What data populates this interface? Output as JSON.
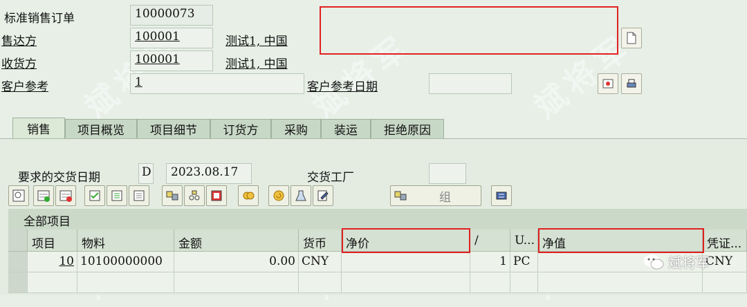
{
  "header": {
    "order_label": "标准销售订单",
    "order_number": "10000073",
    "soldto_label": "售达方",
    "soldto_value": "100001",
    "soldto_desc": "测试1, 中国",
    "shipto_label": "收货方",
    "shipto_value": "100001",
    "shipto_desc": "测试1, 中国",
    "custref_label": "客户参考",
    "custref_value": "1",
    "custref_date_label": "客户参考日期",
    "custref_date_value": ""
  },
  "tabs": [
    {
      "label": "销售",
      "active": true
    },
    {
      "label": "项目概览"
    },
    {
      "label": "项目细节"
    },
    {
      "label": "订货方"
    },
    {
      "label": "采购"
    },
    {
      "label": "装运"
    },
    {
      "label": "拒绝原因"
    }
  ],
  "sales_tab": {
    "req_delivery_label": "要求的交货日期",
    "req_delivery_type": "D",
    "req_delivery_date": "2023.08.17",
    "plant_label": "交货工厂",
    "plant_value": "",
    "group_label": "组"
  },
  "items": {
    "section_title": "全部项目",
    "columns": [
      "项目",
      "物料",
      "金额",
      "货币",
      "净价",
      "/",
      "U...",
      "净值",
      "凭证..."
    ],
    "rows": [
      {
        "item": "10",
        "material": "10100000000",
        "amount": "0.00",
        "currency": "CNY",
        "net_price": "",
        "per": "1",
        "unit": "PC",
        "net_value": "",
        "doc_currency": "CNY"
      }
    ]
  },
  "watermark": {
    "text_brand": "斌将军",
    "wechat_label": "斌将军"
  },
  "colors": {
    "highlight": "#e02020",
    "background": "#e7efe7"
  }
}
